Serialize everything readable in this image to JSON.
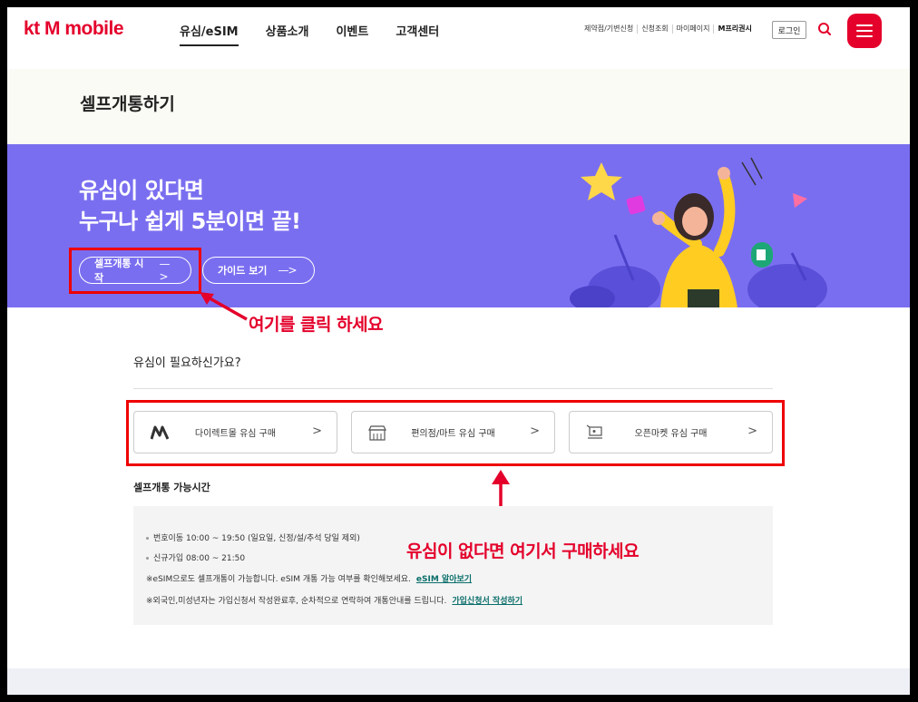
{
  "header": {
    "logo_kt": "kt",
    "logo_rest": "M mobile",
    "nav": [
      "유심/eSIM",
      "상품소개",
      "이벤트",
      "고객센터"
    ],
    "util_links": [
      "제약점/기변신청",
      "신청조회",
      "마이페이지",
      "M프리권시"
    ],
    "login_label": "로그인"
  },
  "page": {
    "title": "셀프개통하기"
  },
  "banner": {
    "line1": "유심이 있다면",
    "line2": "누구나 쉽게 5분이면 끝!",
    "start_label": "셀프개통 시작",
    "guide_label": "가이드 보기",
    "arrow": "—>"
  },
  "annotations": {
    "click_here": "여기를 클릭 하세요",
    "buy_here": "유심이 없다면 여기서 구매하세요"
  },
  "need": {
    "title": "유심이 필요하신가요?",
    "cards": [
      {
        "label": "다이렉트몰 유심 구매",
        "icon": "m-logo-icon"
      },
      {
        "label": "편의점/마트 유심 구매",
        "icon": "store-icon"
      },
      {
        "label": "오픈마켓 유심 구매",
        "icon": "cart-icon"
      }
    ],
    "chevron": ">"
  },
  "hours": {
    "title": "셀프개통 가능시간",
    "line1": "번호이동 10:00 ~ 19:50 (일요일, 신정/설/추석 당일 제외)",
    "line2": "신규가입 08:00 ~ 21:50",
    "note1": "※eSIM으로도 셀프개통이 가능합니다. eSIM 개통 가능 여부를 확인해보세요.",
    "note1_link": "eSIM 알아보기",
    "note2": "※외국인,미성년자는 가입신청서 작성완료후, 순차적으로 연락하여 개통안내를 드립니다.",
    "note2_link": "가입신청서 작성하기"
  },
  "colors": {
    "brand": "#e4002b",
    "banner": "#7a6ef0",
    "annotation": "#e4002b",
    "link": "#0a6e6a"
  }
}
